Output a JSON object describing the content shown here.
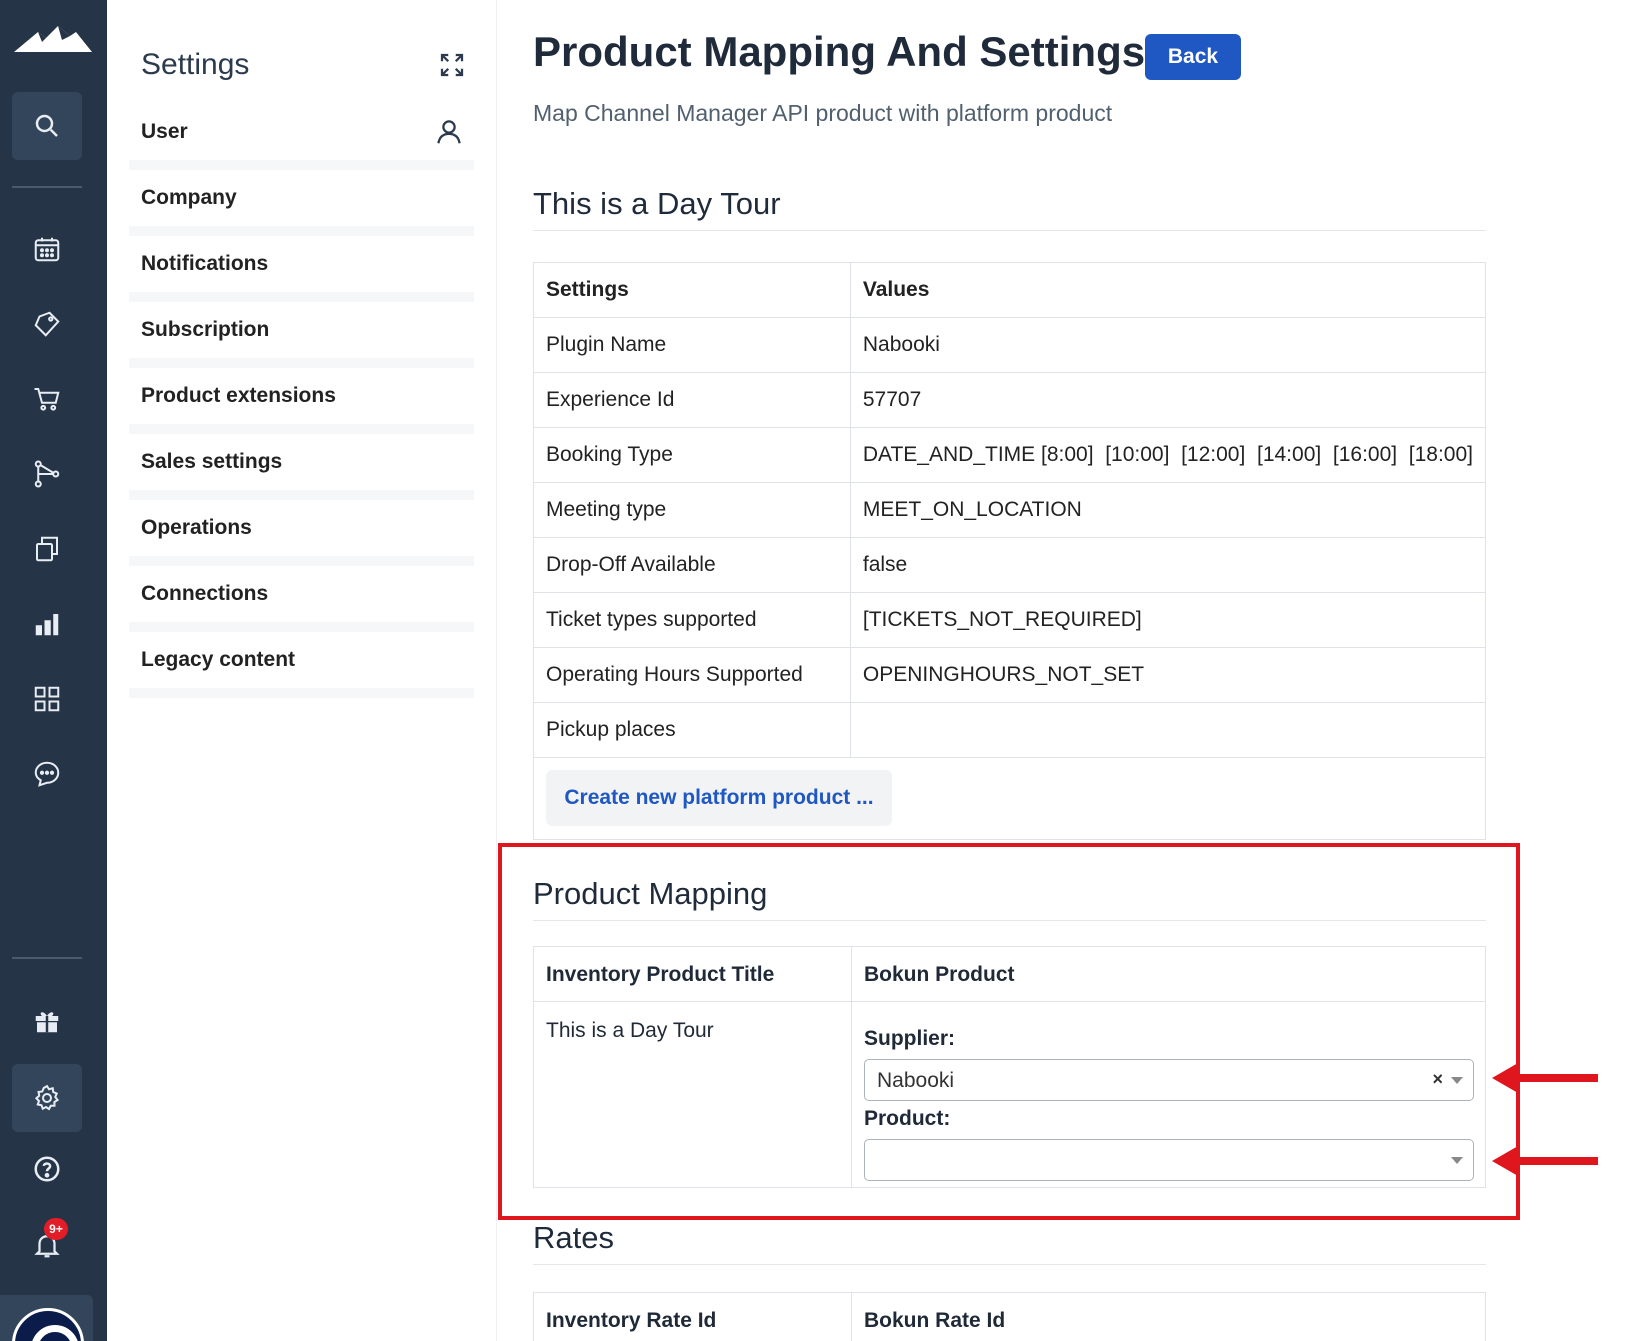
{
  "panel": {
    "title": "Settings",
    "items": [
      {
        "label": "User"
      },
      {
        "label": "Company"
      },
      {
        "label": "Notifications"
      },
      {
        "label": "Subscription"
      },
      {
        "label": "Product extensions"
      },
      {
        "label": "Sales settings"
      },
      {
        "label": "Operations"
      },
      {
        "label": "Connections"
      },
      {
        "label": "Legacy content"
      }
    ]
  },
  "rail": {
    "notifications_badge": "9+"
  },
  "header": {
    "title": "Product Mapping And Settings",
    "back_label": "Back",
    "subtitle": "Map Channel Manager API product with platform product"
  },
  "product_section": {
    "title": "This is a Day Tour",
    "columns": [
      "Settings",
      "Values"
    ],
    "rows": [
      {
        "setting": "Plugin Name",
        "value": "Nabooki"
      },
      {
        "setting": "Experience Id",
        "value": "57707"
      },
      {
        "setting": "Booking Type",
        "value": "DATE_AND_TIME [8:00]  [10:00]  [12:00]  [14:00]  [16:00]  [18:00]"
      },
      {
        "setting": "Meeting type",
        "value": "MEET_ON_LOCATION"
      },
      {
        "setting": "Drop-Off Available",
        "value": "false"
      },
      {
        "setting": "Ticket types supported",
        "value": "[TICKETS_NOT_REQUIRED]"
      },
      {
        "setting": "Operating Hours Supported",
        "value": "OPENINGHOURS_NOT_SET"
      },
      {
        "setting": "Pickup places",
        "value": ""
      }
    ],
    "create_button": "Create new platform product ..."
  },
  "mapping": {
    "title": "Product Mapping",
    "col1": "Inventory Product Title",
    "col2": "Bokun Product",
    "product_title": "This is a Day Tour",
    "supplier_label": "Supplier:",
    "supplier_value": "Nabooki",
    "clear_glyph": "×",
    "product_label": "Product:",
    "product_value": ""
  },
  "rates": {
    "title": "Rates",
    "col1": "Inventory Rate Id",
    "col2": "Bokun Rate Id"
  },
  "colors": {
    "rail": "#253447",
    "accent": "#1f57c3",
    "highlight": "#e0161e"
  }
}
